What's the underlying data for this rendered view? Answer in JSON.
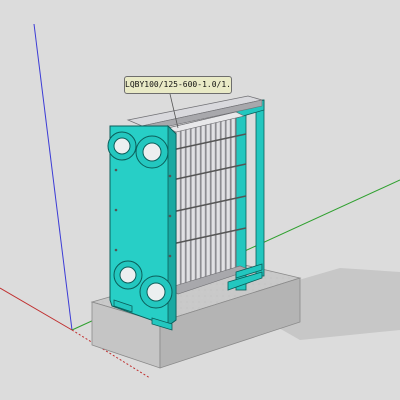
{
  "scene": {
    "label": "LQBY100/125-600-1.0/1.0",
    "axis_colors": {
      "blue": "#3b3bd6",
      "red": "#c03030",
      "green": "#2fa02f"
    },
    "frame_color": "#23c7bf",
    "background": "#dcdcdc"
  }
}
